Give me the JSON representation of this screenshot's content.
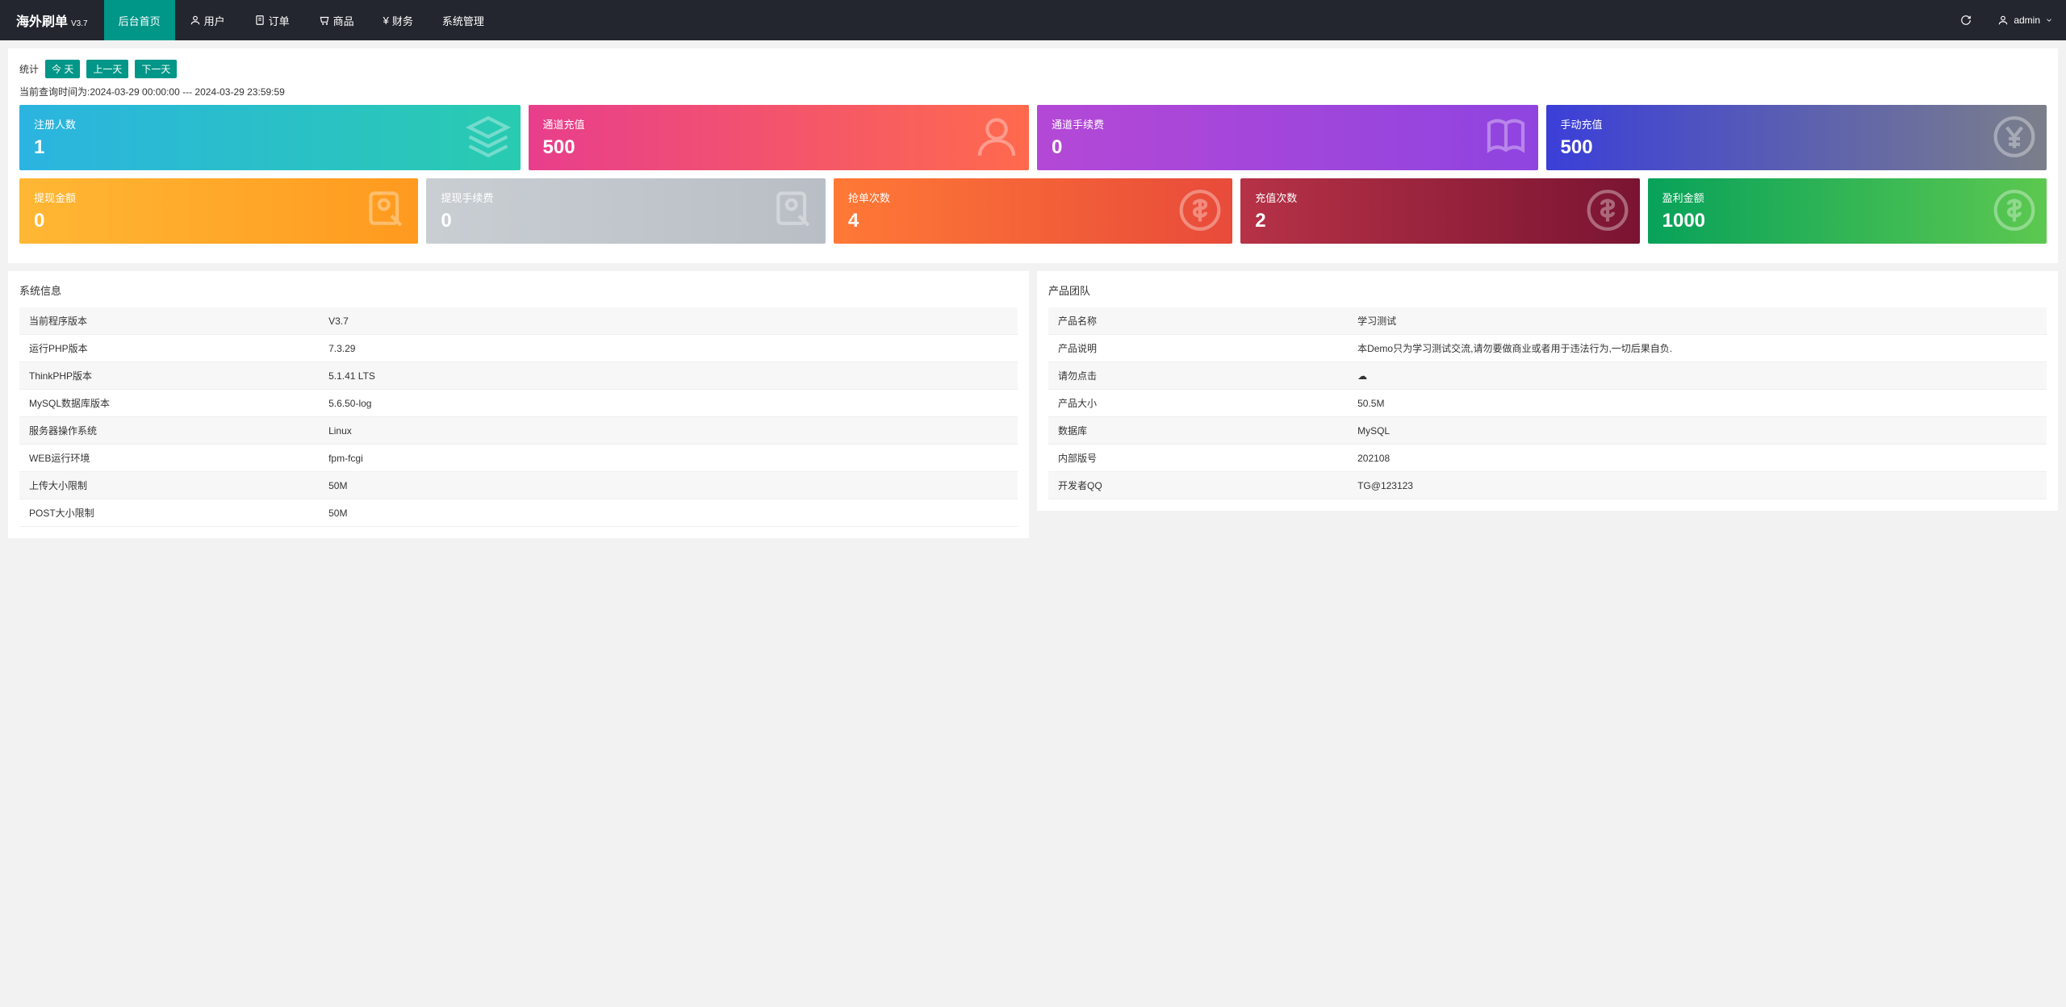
{
  "brand": {
    "name": "海外刷单",
    "version": "V3.7"
  },
  "nav": {
    "items": [
      {
        "label": "后台首页"
      },
      {
        "label": "用户"
      },
      {
        "label": "订单"
      },
      {
        "label": "商品"
      },
      {
        "label": "财务",
        "prefix": "¥ "
      },
      {
        "label": "系统管理"
      }
    ],
    "user": "admin"
  },
  "filter": {
    "label": "统计",
    "today": "今 天",
    "prev": "上一天",
    "next": "下一天"
  },
  "query_time": "当前查询时间为:2024-03-29 00:00:00 --- 2024-03-29 23:59:59",
  "cards_row1": [
    {
      "title": "注册人数",
      "value": "1"
    },
    {
      "title": "通道充值",
      "value": "500"
    },
    {
      "title": "通道手续费",
      "value": "0"
    },
    {
      "title": "手动充值",
      "value": "500"
    }
  ],
  "cards_row2": [
    {
      "title": "提现金额",
      "value": "0"
    },
    {
      "title": "提现手续费",
      "value": "0"
    },
    {
      "title": "抢单次数",
      "value": "4"
    },
    {
      "title": "充值次数",
      "value": "2"
    },
    {
      "title": "盈利金额",
      "value": "1000"
    }
  ],
  "sysinfo": {
    "title": "系统信息",
    "rows": [
      {
        "k": "当前程序版本",
        "v": "V3.7"
      },
      {
        "k": "运行PHP版本",
        "v": "7.3.29"
      },
      {
        "k": "ThinkPHP版本",
        "v": "5.1.41 LTS"
      },
      {
        "k": "MySQL数据库版本",
        "v": "5.6.50-log"
      },
      {
        "k": "服务器操作系统",
        "v": "Linux"
      },
      {
        "k": "WEB运行环境",
        "v": "fpm-fcgi"
      },
      {
        "k": "上传大小限制",
        "v": "50M"
      },
      {
        "k": "POST大小限制",
        "v": "50M"
      }
    ]
  },
  "team": {
    "title": "产品团队",
    "rows": [
      {
        "k": "产品名称",
        "v": "学习测试"
      },
      {
        "k": "产品说明",
        "v": "本Demo只为学习测试交流,请勿要做商业或者用于违法行为,一切后果自负."
      },
      {
        "k": "请勿点击",
        "v": "☁"
      },
      {
        "k": "产品大小",
        "v": "50.5M"
      },
      {
        "k": "数据库",
        "v": "MySQL"
      },
      {
        "k": "内部版号",
        "v": "202108"
      },
      {
        "k": "开发者QQ",
        "v": "TG@123123"
      }
    ]
  }
}
